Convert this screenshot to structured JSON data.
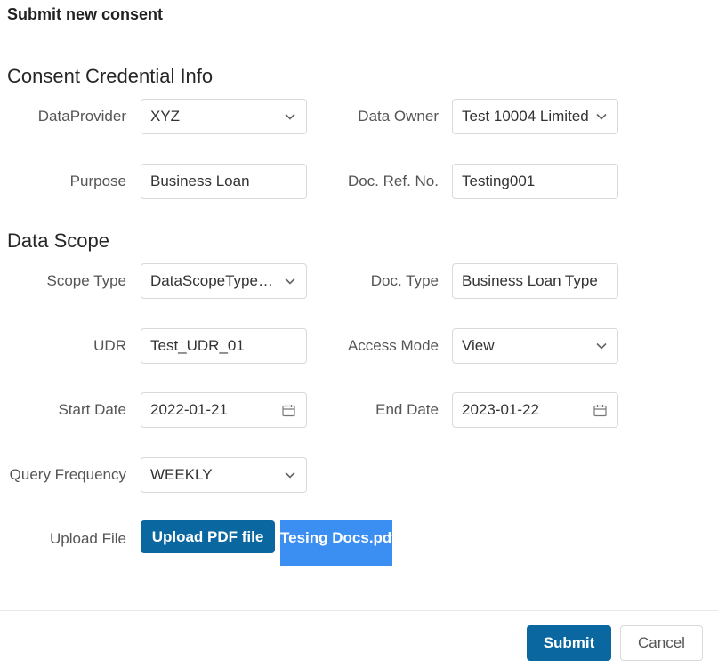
{
  "modal": {
    "title": "Submit new consent"
  },
  "sections": {
    "credential_title": "Consent Credential Info",
    "scope_title": "Data Scope"
  },
  "fields": {
    "data_provider": {
      "label": "DataProvider",
      "value": "XYZ",
      "icon": "chevron-down-icon"
    },
    "data_owner": {
      "label": "Data Owner",
      "value": "Test 10004 Limited",
      "icon": "chevron-down-icon"
    },
    "purpose": {
      "label": "Purpose",
      "value": "Business Loan"
    },
    "doc_ref_no": {
      "label": "Doc. Ref. No.",
      "value": "Testing001"
    },
    "scope_type": {
      "label": "Scope Type",
      "value": "DataScopeTypeBusiness",
      "icon": "chevron-down-icon"
    },
    "doc_type": {
      "label": "Doc. Type",
      "value": "Business Loan Type"
    },
    "udr": {
      "label": "UDR",
      "value": "Test_UDR_01"
    },
    "access_mode": {
      "label": "Access Mode",
      "value": "View",
      "icon": "chevron-down-icon"
    },
    "start_date": {
      "label": "Start Date",
      "value": "2022-01-21",
      "icon": "calendar-icon"
    },
    "end_date": {
      "label": "End Date",
      "value": "2023-01-22",
      "icon": "calendar-icon"
    },
    "query_frequency": {
      "label": "Query Frequency",
      "value": "WEEKLY",
      "icon": "chevron-down-icon"
    },
    "upload_file": {
      "label": "Upload File",
      "button_label": "Upload PDF file",
      "file_name": "Tesing Docs.pdf"
    }
  },
  "footer": {
    "submit_label": "Submit",
    "cancel_label": "Cancel"
  },
  "colors": {
    "primary": "#0b67a0",
    "file_chip": "#3b8ff3"
  }
}
